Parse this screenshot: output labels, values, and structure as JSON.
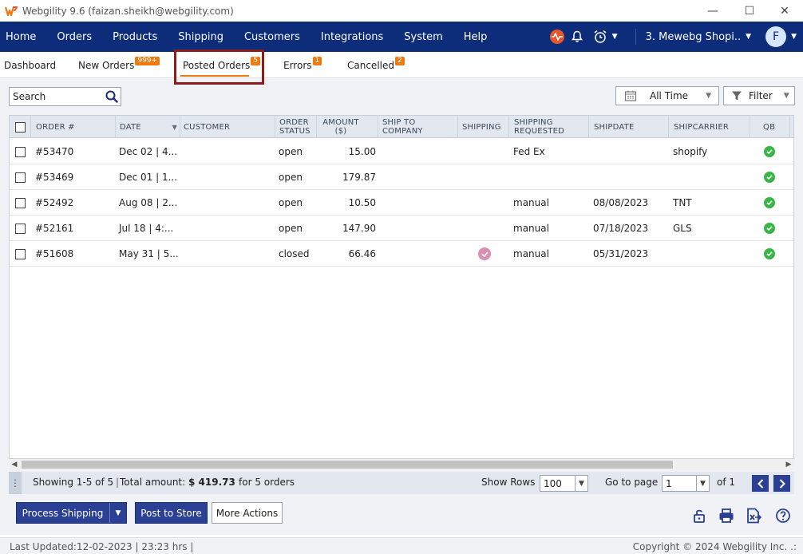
{
  "window": {
    "title": "Webgility 9.6 (faizan.sheikh@webgility.com)",
    "minimize_glyph": "—",
    "maximize_glyph": "☐",
    "close_glyph": "✕"
  },
  "nav": {
    "items": [
      "Home",
      "Orders",
      "Products",
      "Shipping",
      "Customers",
      "Integrations",
      "System",
      "Help"
    ],
    "store": "3. Mewebg Shopi..",
    "avatar": "F"
  },
  "tabs": [
    {
      "label": "Dashboard",
      "badge": ""
    },
    {
      "label": "New Orders",
      "badge": "999+"
    },
    {
      "label": "Posted Orders",
      "badge": "5"
    },
    {
      "label": "Errors",
      "badge": "1"
    },
    {
      "label": "Cancelled",
      "badge": "2"
    }
  ],
  "toolbar": {
    "search_value": "Search",
    "date_range": "All Time",
    "filter_label": "Filter"
  },
  "table": {
    "headers": {
      "order": "ORDER #",
      "date": "DATE",
      "customer": "CUSTOMER",
      "order_status_1": "ORDER",
      "order_status_2": "STATUS",
      "amount_1": "AMOUNT",
      "amount_2": "($)",
      "ship_to_1": "SHIP TO",
      "ship_to_2": "COMPANY",
      "shipping": "SHIPPING",
      "shipping_req_1": "SHIPPING",
      "shipping_req_2": "REQUESTED",
      "shipdate": "SHIPDATE",
      "shipcarrier": "SHIPCARRIER",
      "qb": "QB"
    },
    "rows": [
      {
        "order": "#53470",
        "date": "Dec 02 | 4...",
        "status": "open",
        "amount": "15.00",
        "shipping_mark": false,
        "requested": "Fed Ex",
        "shipdate": "",
        "carrier": "shopify"
      },
      {
        "order": "#53469",
        "date": "Dec 01 | 1...",
        "status": "open",
        "amount": "179.87",
        "shipping_mark": false,
        "requested": "",
        "shipdate": "",
        "carrier": ""
      },
      {
        "order": "#52492",
        "date": "Aug 08 | 2...",
        "status": "open",
        "amount": "10.50",
        "shipping_mark": false,
        "requested": "manual",
        "shipdate": "08/08/2023",
        "carrier": "TNT"
      },
      {
        "order": "#52161",
        "date": "Jul 18 | 4:...",
        "status": "open",
        "amount": "147.90",
        "shipping_mark": false,
        "requested": "manual",
        "shipdate": "07/18/2023",
        "carrier": "GLS"
      },
      {
        "order": "#51608",
        "date": "May 31 | 5...",
        "status": "closed",
        "amount": "66.46",
        "shipping_mark": true,
        "requested": "manual",
        "shipdate": "05/31/2023",
        "carrier": ""
      }
    ]
  },
  "footer": {
    "showing": "Showing 1-5 of 5",
    "total_label": "Total amount:",
    "total_value": "$ 419.73",
    "total_suffix": "for 5 orders",
    "show_rows_label": "Show Rows",
    "show_rows_value": "100",
    "goto_label": "Go to page",
    "goto_value": "1",
    "of_pages": "of 1"
  },
  "actions": {
    "process_shipping": "Process Shipping",
    "post_to_store": "Post to Store",
    "more_actions": "More Actions"
  },
  "bottom": {
    "last_updated": "Last Updated:12-02-2023 | 23:23 hrs |",
    "copyright": "Copyright © 2024 Webgility Inc. .:"
  },
  "colors": {
    "nav_bg": "#0d2c7a",
    "accent_orange": "#f07a10",
    "primary_button": "#2b3f94",
    "qb_ok": "#3bb449",
    "highlight_box": "#8b1d1d"
  }
}
